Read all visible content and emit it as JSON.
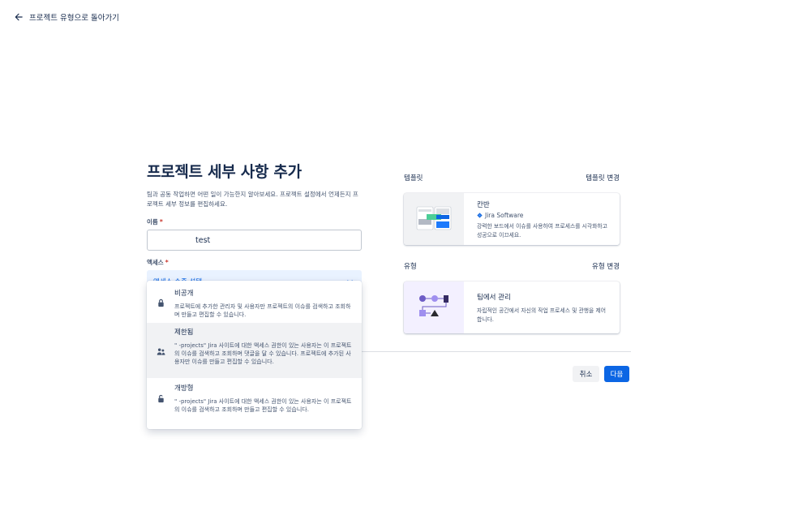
{
  "back": {
    "label": "프로젝트 유형으로 돌아가기"
  },
  "form": {
    "title": "프로젝트 세부 사항 추가",
    "description": "팀과 공동 작업하면 어떤 일이 가능한지 알아보세요. 프로젝트 설정에서 언제든지 프로젝트 세부 정보를 편집하세요.",
    "name_label": "이름",
    "name_value": "test",
    "access_label": "액세스",
    "required_mark": "*",
    "access_select_label": "액세스 수준 선택"
  },
  "access_options": [
    {
      "title": "비공개",
      "description": "프로젝트에 추가한 관리자 및 사용자만 프로젝트의 이슈를 검색하고 조회하며 만들고 편집할 수 있습니다.",
      "icon": "lock-icon"
    },
    {
      "title": "제한됨",
      "description": "\"                    -projects\" Jira 사이트에 대한 액세스 권한이 있는 사용자는 이 프로젝트의 이슈를 검색하고 조회하며 댓글을 달 수 있습니다. 프로젝트에 추가된 사용자만 이슈를 만들고 편집할 수 있습니다.",
      "icon": "people-icon"
    },
    {
      "title": "개방형",
      "description": "\"                    -projects\" Jira 사이트에 대한 액세스 권한이 있는 사용자는 이 프로젝트의 이슈를 검색하고 조회하며 만들고 편집할 수 있습니다.",
      "icon": "unlock-icon"
    }
  ],
  "template": {
    "heading": "템플릿",
    "change_label": "템플릿 변경",
    "card_title": "칸반",
    "card_product": "Jira Software",
    "card_desc": "강력한 보드에서 이슈를 사용하여 프로세스를 시각화하고 성공으로 이끄세요."
  },
  "type": {
    "heading": "유형",
    "change_label": "유형 변경",
    "card_title": "팀에서 관리",
    "card_desc": "자립적인 공간에서 자신의 작업 프로세스 및 관행을 제어합니다."
  },
  "actions": {
    "cancel": "취소",
    "next": "다음"
  },
  "colors": {
    "primary": "#0c66e4",
    "select_bg": "#e9f2ff",
    "selected_option_bg": "#f1f2f4"
  }
}
